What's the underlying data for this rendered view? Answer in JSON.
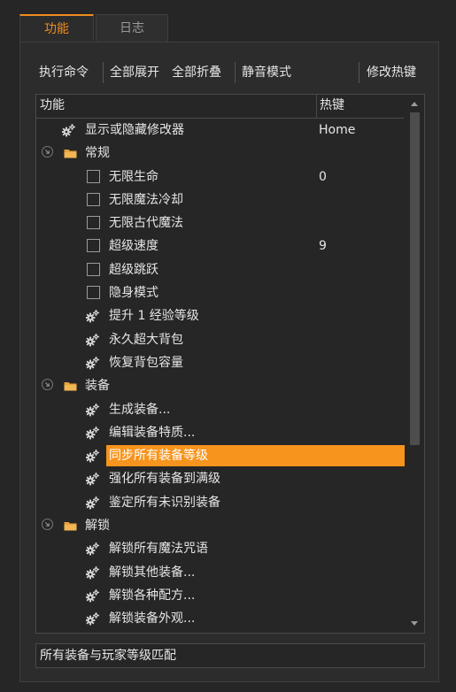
{
  "tabs": [
    {
      "label": "功能",
      "active": true
    },
    {
      "label": "日志",
      "active": false
    }
  ],
  "toolbar": {
    "execute": "执行命令",
    "expand_all": "全部展开",
    "collapse_all": "全部折叠",
    "silent_mode": "静音模式",
    "edit_hotkeys": "修改热键"
  },
  "tree": {
    "columns": {
      "feature": "功能",
      "hotkey": "热键"
    },
    "rows": [
      {
        "label": "显示或隐藏修改器",
        "type": "action",
        "hotkey": "Home"
      },
      {
        "label": "常规",
        "type": "folder",
        "hotkey": ""
      },
      {
        "label": "无限生命",
        "type": "checkbox",
        "hotkey": "0"
      },
      {
        "label": "无限魔法冷却",
        "type": "checkbox",
        "hotkey": ""
      },
      {
        "label": "无限古代魔法",
        "type": "checkbox",
        "hotkey": ""
      },
      {
        "label": "超级速度",
        "type": "checkbox",
        "hotkey": "9"
      },
      {
        "label": "超级跳跃",
        "type": "checkbox",
        "hotkey": ""
      },
      {
        "label": "隐身模式",
        "type": "checkbox",
        "hotkey": ""
      },
      {
        "label": "提升 1 经验等级",
        "type": "action",
        "hotkey": ""
      },
      {
        "label": "永久超大背包",
        "type": "action",
        "hotkey": ""
      },
      {
        "label": "恢复背包容量",
        "type": "action",
        "hotkey": ""
      },
      {
        "label": "装备",
        "type": "folder",
        "hotkey": ""
      },
      {
        "label": "生成装备...",
        "type": "action",
        "hotkey": ""
      },
      {
        "label": "编辑装备特质...",
        "type": "action",
        "hotkey": ""
      },
      {
        "label": "同步所有装备等级",
        "type": "action",
        "hotkey": "",
        "selected": true
      },
      {
        "label": "强化所有装备到满级",
        "type": "action",
        "hotkey": ""
      },
      {
        "label": "鉴定所有未识别装备",
        "type": "action",
        "hotkey": ""
      },
      {
        "label": "解锁",
        "type": "folder",
        "hotkey": ""
      },
      {
        "label": "解锁所有魔法咒语",
        "type": "action",
        "hotkey": ""
      },
      {
        "label": "解锁其他装备...",
        "type": "action",
        "hotkey": ""
      },
      {
        "label": "解锁各种配方...",
        "type": "action",
        "hotkey": ""
      },
      {
        "label": "解锁装备外观...",
        "type": "action",
        "hotkey": ""
      }
    ]
  },
  "status": {
    "text": "所有装备与玩家等级匹配"
  },
  "colors": {
    "accent": "#f08c1e",
    "selection": "#f7941d",
    "folder": "#e8a23a",
    "gear": "#d0d0d0"
  }
}
